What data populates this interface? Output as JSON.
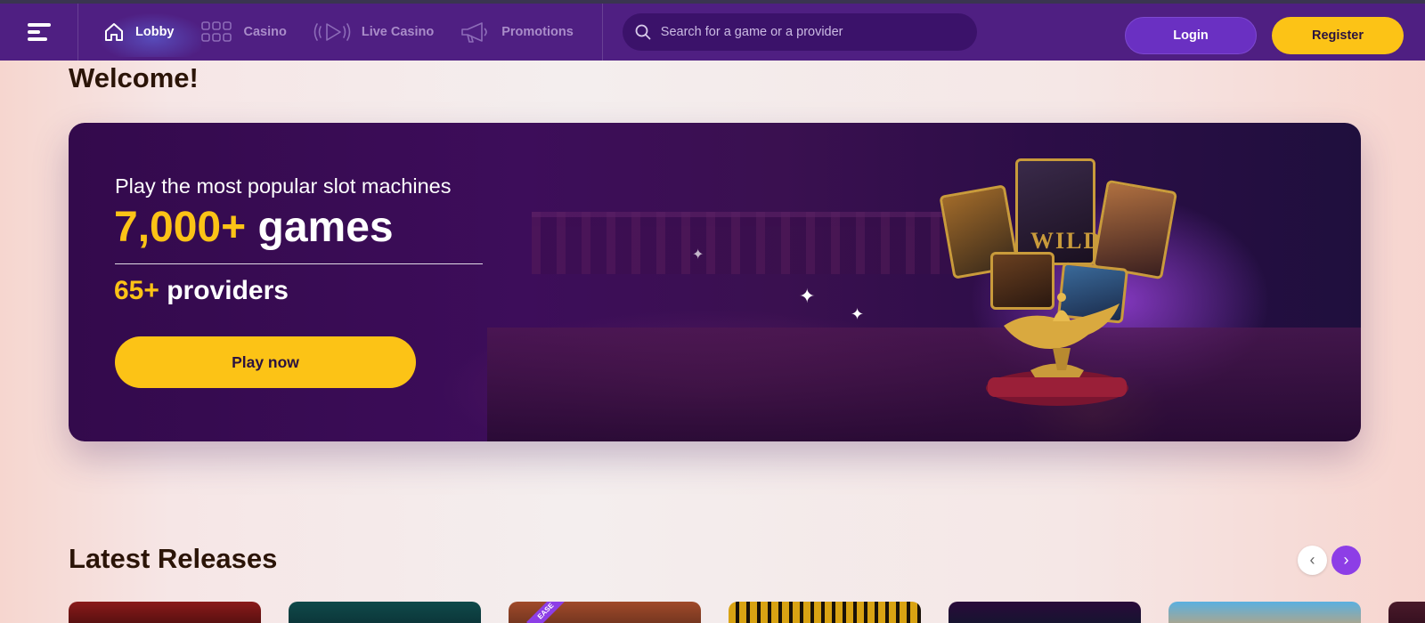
{
  "header": {
    "nav": [
      {
        "label": "Lobby",
        "icon": "home-icon",
        "active": true
      },
      {
        "label": "Casino",
        "icon": "grid-icon",
        "active": false
      },
      {
        "label": "Live Casino",
        "icon": "play-icon",
        "active": false
      },
      {
        "label": "Promotions",
        "icon": "megaphone-icon",
        "active": false
      }
    ],
    "search_placeholder": "Search for a game or a provider",
    "login_label": "Login",
    "register_label": "Register"
  },
  "page": {
    "welcome_title": "Welcome!",
    "latest_title": "Latest Releases"
  },
  "hero": {
    "subtitle": "Play the most popular slot machines",
    "games_count": "7,000+",
    "games_word": "games",
    "providers_count": "65+",
    "providers_word": "providers",
    "cta_label": "Play now",
    "card_text": "WILD"
  },
  "carousel": {
    "prev_label": "‹",
    "next_label": "›",
    "ribbon_text": "EASE"
  },
  "colors": {
    "brand_purple": "#4f1f82",
    "accent_yellow": "#fcc316",
    "heading_brown": "#2b1407",
    "carousel_active": "#8d3ee6"
  }
}
